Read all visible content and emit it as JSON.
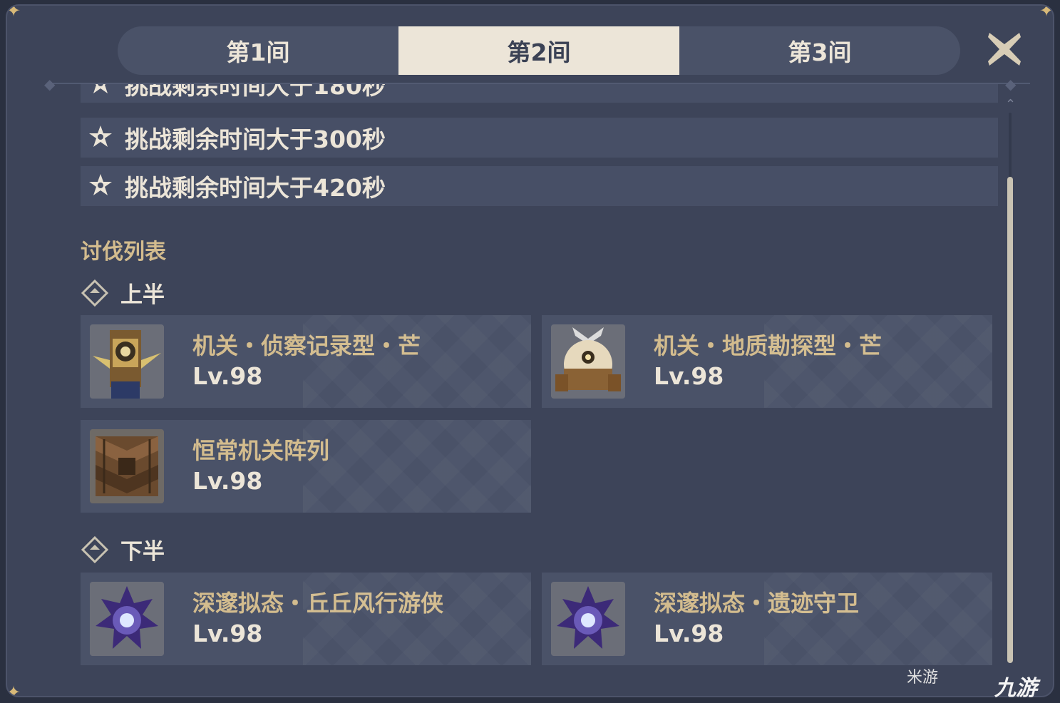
{
  "tabs": [
    {
      "label": "第1间",
      "active": false
    },
    {
      "label": "第2间",
      "active": true
    },
    {
      "label": "第3间",
      "active": false
    }
  ],
  "conditions": [
    {
      "text": "挑战剩余时间大于180秒",
      "partially_visible": true
    },
    {
      "text": "挑战剩余时间大于300秒"
    },
    {
      "text": "挑战剩余时间大于420秒"
    }
  ],
  "enemy_list": {
    "title": "讨伐列表",
    "first_half": {
      "label": "上半",
      "enemies": [
        {
          "name": "机关・侦察记录型・芒",
          "level": "Lv.98",
          "icon": "recon-log-mek-icon"
        },
        {
          "name": "机关・地质勘探型・芒",
          "level": "Lv.98",
          "icon": "geological-survey-mek-icon"
        },
        {
          "name": "恒常机关阵列",
          "level": "Lv.98",
          "icon": "perpetual-mechanical-array-icon"
        }
      ]
    },
    "second_half": {
      "label": "下半",
      "enemies": [
        {
          "name": "深邃拟态・丘丘风行游侠",
          "level": "Lv.98",
          "icon": "abyssal-mimic-hilichurl-ranger-icon"
        },
        {
          "name": "深邃拟态・遗迹守卫",
          "level": "Lv.98",
          "icon": "abyssal-mimic-ruin-guard-icon"
        }
      ]
    }
  },
  "watermark": {
    "text_a": "米游",
    "text_b": "九游"
  },
  "colors": {
    "panel": "#3d4459",
    "tab_active_bg": "#ece5d8",
    "gold_text": "#d3bc8e",
    "light_text": "#ece5d8"
  }
}
